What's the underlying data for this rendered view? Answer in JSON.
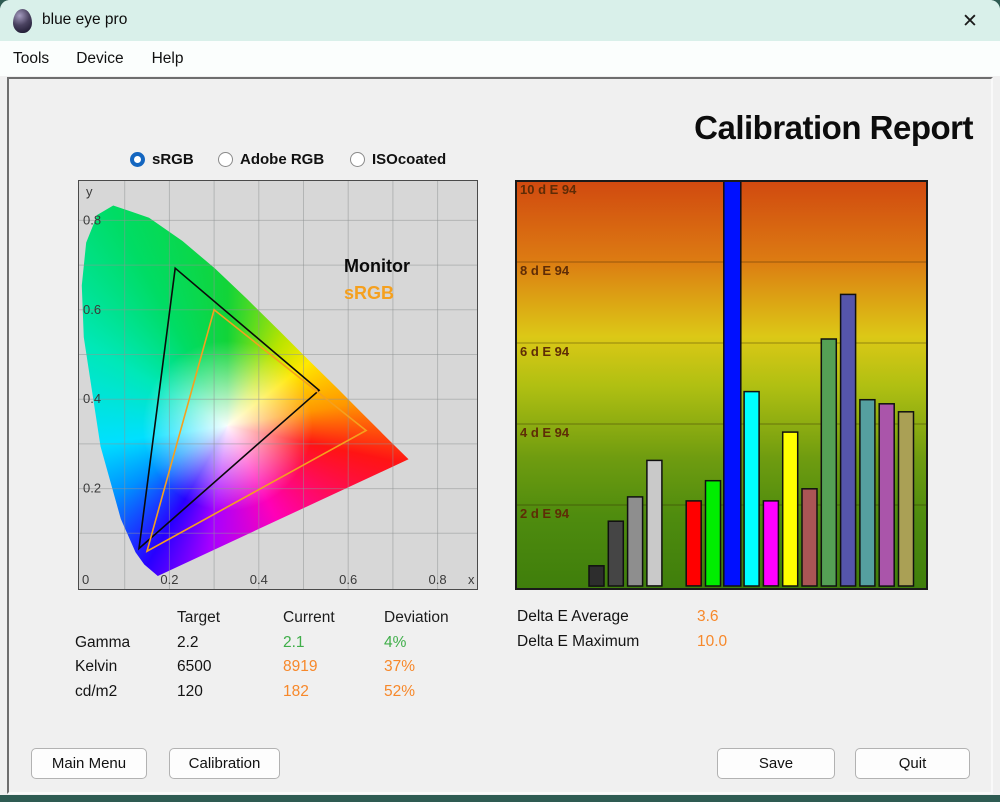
{
  "window": {
    "title": "blue eye pro",
    "close_glyph": "✕"
  },
  "menu": {
    "items": [
      {
        "label": "Tools"
      },
      {
        "label": "Device"
      },
      {
        "label": "Help"
      }
    ]
  },
  "report": {
    "title": "Calibration Report"
  },
  "profiles": {
    "options": [
      {
        "label": "sRGB",
        "selected": true
      },
      {
        "label": "Adobe RGB",
        "selected": false
      },
      {
        "label": "ISOcoated",
        "selected": false
      }
    ]
  },
  "chart_data": [
    {
      "type": "area",
      "name": "cie-1931-chromaticity-diagram",
      "xlabel": "x",
      "ylabel": "y",
      "xlim": [
        0,
        0.89
      ],
      "ylim": [
        0,
        0.91
      ],
      "grid_step": 0.1,
      "x_ticks": [
        0,
        0.2,
        0.4,
        0.6,
        0.8
      ],
      "y_ticks": [
        0.2,
        0.4,
        0.6,
        0.8
      ],
      "legend_position": "upper-right-inside",
      "series": [
        {
          "name": "Monitor",
          "color": "#0a0a0a",
          "points": [
            [
              0.213,
              0.693
            ],
            [
              0.535,
              0.42
            ],
            [
              0.132,
              0.066
            ]
          ]
        },
        {
          "name": "sRGB",
          "color": "#f5a01e",
          "points": [
            [
              0.3,
              0.6
            ],
            [
              0.64,
              0.33
            ],
            [
              0.15,
              0.06
            ]
          ]
        }
      ]
    },
    {
      "type": "bar",
      "name": "delta-e94-per-patch",
      "ylabel": "d E 94",
      "ylim": [
        0,
        10
      ],
      "grid": true,
      "gridlines": [
        {
          "value": 2,
          "label": "2 d E 94"
        },
        {
          "value": 4,
          "label": "4 d E 94"
        },
        {
          "value": 6,
          "label": "6 d E 94"
        },
        {
          "value": 8,
          "label": "8 d E 94"
        },
        {
          "value": 10,
          "label": "10 d E 94"
        }
      ],
      "bars": [
        {
          "color": "#2d2d2d",
          "value": 0.5
        },
        {
          "color": "#454545",
          "value": 1.6
        },
        {
          "color": "#8e8e8e",
          "value": 2.2
        },
        {
          "color": "#c9c9c9",
          "value": 3.1
        },
        {
          "color": "#ff0000",
          "value": 2.1
        },
        {
          "color": "#00ee00",
          "value": 2.6
        },
        {
          "color": "#0010ff",
          "value": 10.0
        },
        {
          "color": "#00ffff",
          "value": 4.8
        },
        {
          "color": "#ff00ff",
          "value": 2.1
        },
        {
          "color": "#ffff00",
          "value": 3.8
        },
        {
          "color": "#aa5555",
          "value": 2.4
        },
        {
          "color": "#55a055",
          "value": 6.1
        },
        {
          "color": "#5555aa",
          "value": 7.2
        },
        {
          "color": "#55a0a0",
          "value": 4.6
        },
        {
          "color": "#aa55aa",
          "value": 4.5
        },
        {
          "color": "#aaa055",
          "value": 4.3
        }
      ]
    }
  ],
  "results_table": {
    "columns": [
      "Target",
      "Current",
      "Deviation"
    ],
    "rows": [
      {
        "label": "Gamma",
        "target": "2.2",
        "current": "2.1",
        "deviation": "4%",
        "status": "good"
      },
      {
        "label": "Kelvin",
        "target": "6500",
        "current": "8919",
        "deviation": "37%",
        "status": "warn"
      },
      {
        "label": "cd/m2",
        "target": "120",
        "current": "182",
        "deviation": "52%",
        "status": "warn"
      }
    ]
  },
  "delta_e": {
    "average_label": "Delta E Average",
    "average": "3.6",
    "maximum_label": "Delta E Maximum",
    "maximum": "10.0"
  },
  "buttons": {
    "main_menu": "Main Menu",
    "calibration": "Calibration",
    "save": "Save",
    "quit": "Quit"
  },
  "colors": {
    "good": "#3fae49",
    "warn": "#f7882a",
    "selected_radio": "#1466c0",
    "srgb_line": "#f5a01e"
  }
}
